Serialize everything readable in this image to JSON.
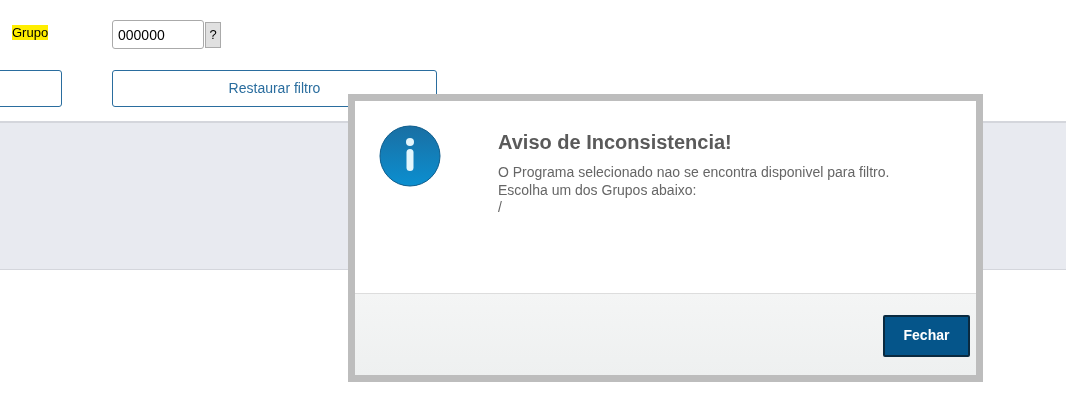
{
  "filter": {
    "group_label": "Grupo",
    "group_value": "000000",
    "help_button": "?",
    "restore_button": "Restaurar filtro"
  },
  "dialog": {
    "title": "Aviso de Inconsistencia!",
    "message": [
      "O Programa selecionado nao se encontra disponivel para filtro.",
      "Escolha um dos Grupos abaixo:",
      "/"
    ],
    "close_button": "Fechar"
  }
}
